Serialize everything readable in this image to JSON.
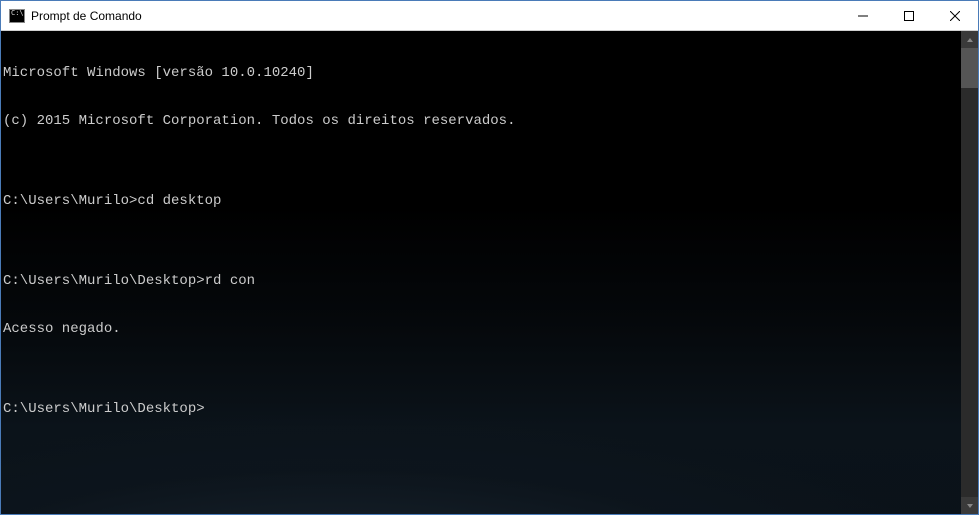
{
  "window": {
    "title": "Prompt de Comando"
  },
  "terminal": {
    "lines": [
      "Microsoft Windows [versão 10.0.10240]",
      "(c) 2015 Microsoft Corporation. Todos os direitos reservados.",
      "",
      "C:\\Users\\Murilo>cd desktop",
      "",
      "C:\\Users\\Murilo\\Desktop>rd con",
      "Acesso negado.",
      "",
      "C:\\Users\\Murilo\\Desktop>"
    ],
    "icon_text": "C:\\"
  }
}
